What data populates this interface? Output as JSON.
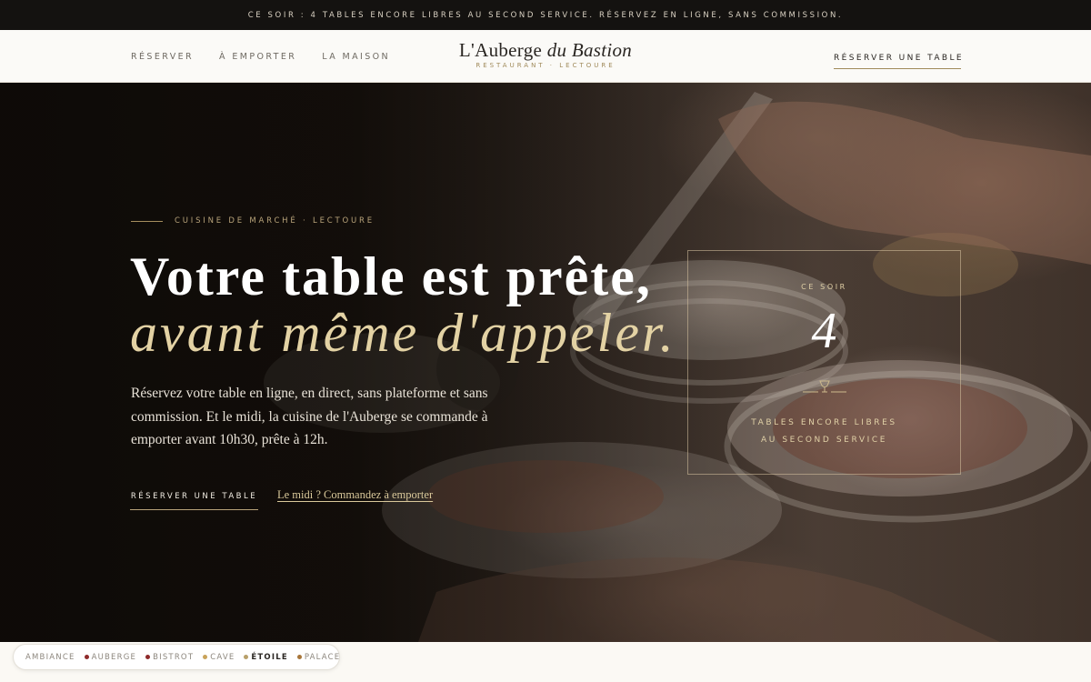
{
  "announcement": "CE SOIR : 4 TABLES ENCORE LIBRES AU SECOND SERVICE. RÉSERVEZ EN LIGNE, SANS COMMISSION.",
  "header": {
    "nav": [
      "RÉSERVER",
      "À EMPORTER",
      "LA MAISON"
    ],
    "logo_main_a": "L'Auberge",
    "logo_main_b": "du Bastion",
    "logo_sub": "RESTAURANT · LECTOURE",
    "cta": "RÉSERVER UNE TABLE"
  },
  "hero": {
    "eyebrow": "CUISINE DE MARCHÉ · LECTOURE",
    "title_line1": "Votre table est prête,",
    "title_line2": "avant même d'appeler.",
    "lead": "Réservez votre table en ligne, en direct, sans plateforme et sans commission. Et le midi, la cuisine de l'Auberge se commande à emporter avant 10h30, prête à 12h.",
    "cta": "RÉSERVER UNE TABLE",
    "link": "Le midi ? Commandez à emporter"
  },
  "tonight": {
    "label": "CE SOIR",
    "count": "4",
    "line1": "TABLES ENCORE LIBRES",
    "line2": "AU SECOND SERVICE",
    "icon": "wine-glass-icon"
  },
  "ambiance": {
    "label": "AMBIANCE",
    "options": [
      {
        "label": "AUBERGE",
        "color": "#8e2a2a"
      },
      {
        "label": "BISTROT",
        "color": "#8e2a2a"
      },
      {
        "label": "CAVE",
        "color": "#c9a35a"
      },
      {
        "label": "ÉTOILE",
        "color": "#b8a06a",
        "active": true
      },
      {
        "label": "PALACE",
        "color": "#a8763a"
      }
    ]
  },
  "colors": {
    "accent_gold": "#b8a37a",
    "dark": "#141210",
    "italic_title": "#e3d2a4"
  }
}
